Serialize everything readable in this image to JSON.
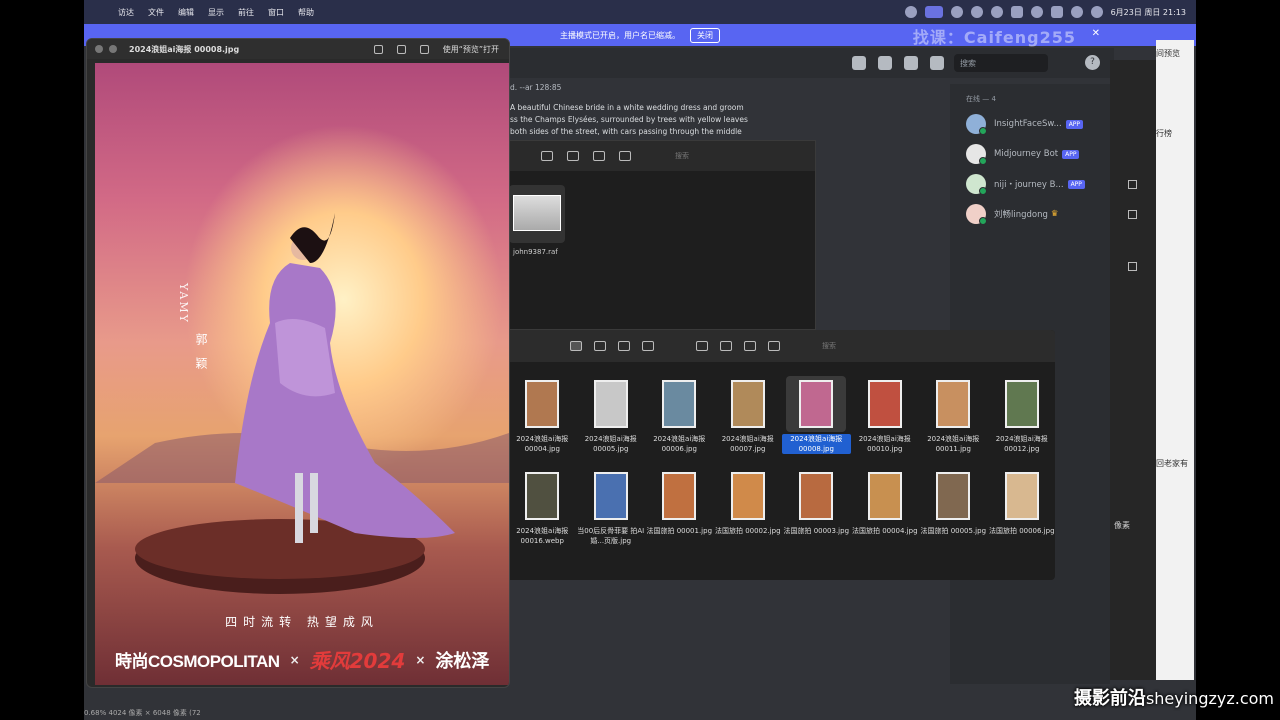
{
  "menubar": {
    "items": [
      "访达",
      "文件",
      "编辑",
      "显示",
      "前往",
      "窗口",
      "帮助"
    ],
    "datetime": "6月23日 周日 21:13"
  },
  "banner": {
    "text": "主播模式已开启，用户名已缩减。",
    "button": "关闭",
    "watermark": "找课：Caifeng255"
  },
  "discord": {
    "search_placeholder": "搜索",
    "help": "?",
    "prompt_tail": "d. --ar 128:85",
    "message": "A beautiful Chinese bride in a white wedding dress and groom ss the Champs Elysées, surrounded by trees with yellow leaves both sides of the street, with cars passing through the middle",
    "members_header": "在线 — 4",
    "members": [
      {
        "name": "InsightFaceSw...",
        "tag": "APP",
        "color": "#8fb0d8"
      },
      {
        "name": "Midjourney Bot",
        "tag": "APP",
        "color": "#e6e6e6"
      },
      {
        "name": "niji・journey B...",
        "tag": "APP",
        "color": "#cfe6cf"
      },
      {
        "name": "刘畅lingdong",
        "tag": "",
        "color": "#f0d0c8"
      }
    ]
  },
  "finder_small": {
    "search_placeholder": "搜索",
    "file": "john9387.raf"
  },
  "finder": {
    "search_placeholder": "搜索",
    "files": [
      {
        "name": "2024浪姐ai海报 00004.jpg",
        "color": "#b07850",
        "selected": false
      },
      {
        "name": "2024浪姐ai海报 00005.jpg",
        "color": "#c8c8c8",
        "selected": false
      },
      {
        "name": "2024浪姐ai海报 00006.jpg",
        "color": "#6a8aa0",
        "selected": false
      },
      {
        "name": "2024浪姐ai海报 00007.jpg",
        "color": "#b08a5a",
        "selected": false
      },
      {
        "name": "2024浪姐ai海报 00008.jpg",
        "color": "#c06890",
        "selected": true
      },
      {
        "name": "2024浪姐ai海报 00010.jpg",
        "color": "#c05040",
        "selected": false
      },
      {
        "name": "2024浪姐ai海报 00011.jpg",
        "color": "#c89060",
        "selected": false
      },
      {
        "name": "2024浪姐ai海报 00012.jpg",
        "color": "#607850",
        "selected": false
      },
      {
        "name": "2024浪姐ai海报 00016.webp",
        "color": "#505040",
        "selected": false
      },
      {
        "name": "当00后反骨菲要 拍AI婚...页版.jpg",
        "color": "#4a70b0",
        "selected": false
      },
      {
        "name": "法国旅拍 00001.jpg",
        "color": "#c07040",
        "selected": false
      },
      {
        "name": "法国旅拍 00002.jpg",
        "color": "#d08a4a",
        "selected": false
      },
      {
        "name": "法国旅拍 00003.jpg",
        "color": "#b86a40",
        "selected": false
      },
      {
        "name": "法国旅拍 00004.jpg",
        "color": "#c89050",
        "selected": false
      },
      {
        "name": "法国旅拍 00005.jpg",
        "color": "#806850",
        "selected": false
      },
      {
        "name": "法国旅拍 00006.jpg",
        "color": "#d8b890",
        "selected": false
      }
    ]
  },
  "preview": {
    "title": "2024浪姐ai海报 00008.jpg",
    "open_with": "使用“预览”打开",
    "poster": {
      "name_en": "YAMY",
      "name_cn": "郭 颖",
      "slogan": "四时流转  热望成风",
      "logo1": "時尚COSMOPOLITAN",
      "x1": "×",
      "logo2": "乘风2024",
      "x2": "×",
      "logo3": "涂松泽"
    }
  },
  "right_app": {
    "title": "间预览",
    "line1": "行榜",
    "line2": "回老家有",
    "line3": "像素"
  },
  "status": {
    "zoom": "0.68%",
    "dims": "4024 像素 × 6048 像素 (72"
  },
  "site_watermark": {
    "cn": "摄影前沿",
    "en": "sheyingzyz.com"
  }
}
